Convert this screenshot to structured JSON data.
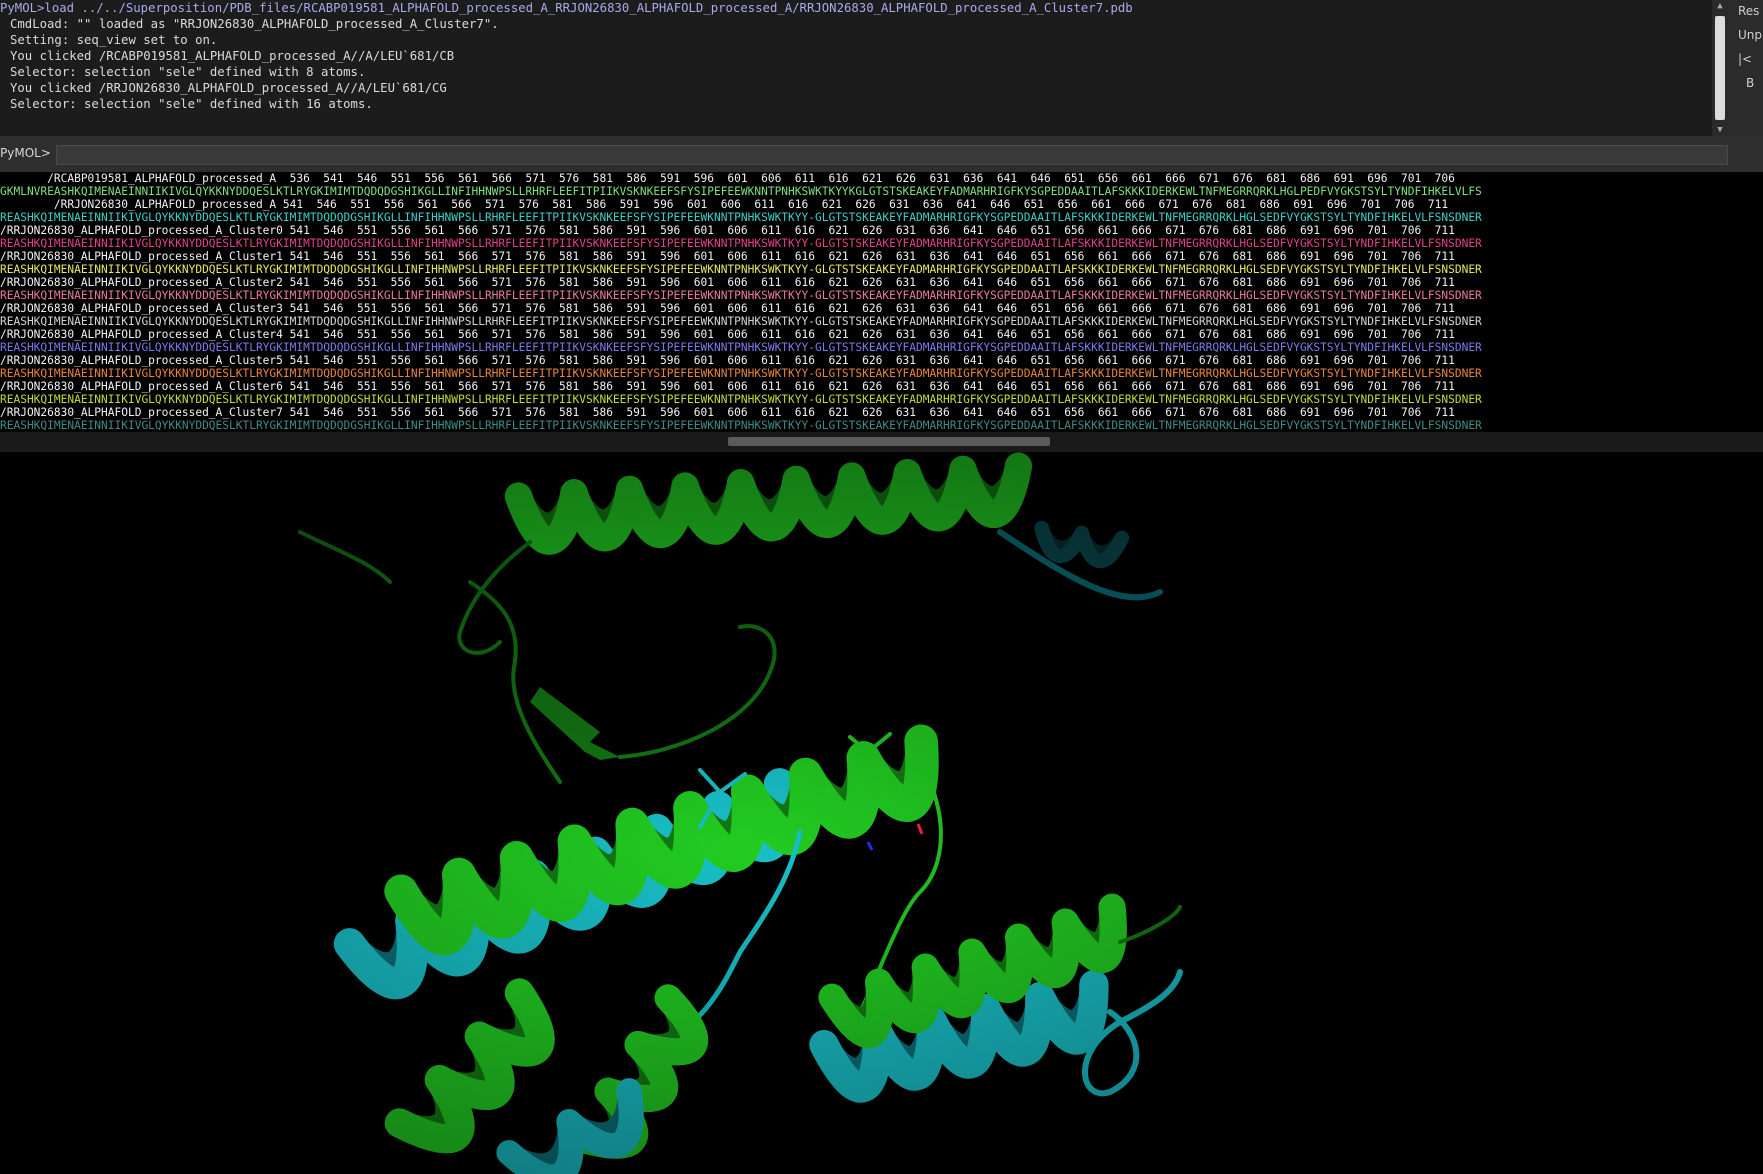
{
  "console": {
    "lines": [
      {
        "cls": "cmd",
        "text": "PyMOL>load ../../Superposition/PDB_files/RCABP019581_ALPHAFOLD_processed_A_RRJON26830_ALPHAFOLD_processed_A/RRJON26830_ALPHAFOLD_processed_A_Cluster7.pdb"
      },
      {
        "cls": "out",
        "text": "CmdLoad: \"\" loaded as \"RRJON26830_ALPHAFOLD_processed_A_Cluster7\"."
      },
      {
        "cls": "out",
        "text": "Setting: seq_view set to on."
      },
      {
        "cls": "out",
        "text": "You clicked /RCABP019581_ALPHAFOLD_processed_A//A/LEU`681/CB"
      },
      {
        "cls": "out",
        "text": "Selector: selection \"sele\" defined with 8 atoms."
      },
      {
        "cls": "out",
        "text": "You clicked /RRJON26830_ALPHAFOLD_processed_A//A/LEU`681/CG"
      },
      {
        "cls": "out",
        "text": "Selector: selection \"sele\" defined with 16 atoms."
      }
    ]
  },
  "right_panel": {
    "buttons": [
      "Res",
      "Unp",
      "|<",
      "B"
    ]
  },
  "command_line": {
    "prompt": "PyMOL>",
    "value": ""
  },
  "sequence_view": {
    "rows": [
      {
        "kind": "nums",
        "text": "       /RCABP019581_ALPHAFOLD_processed_A  536  541  546  551  556  561  566  571  576  581  586  591  596  601  606  611  616  621  626  631  636  641  646  651  656  661  666  671  676  681  686  691  696  701  706"
      },
      {
        "kind": "seq",
        "color": "#7ee07e",
        "text": "GKMLNVREASHKQIMENAEINNIIKIVGLQYKKNYDDQESLKTLRYGKIMIMTDQDQDGSHIKGLLINFIHHNWPSLLRHRFLEEFITPIIKVSKNKEEFSFYSIPEFEEWKNNTPNHKSWKTKYYKGLGTSTSKEAKEYFADMARHRIGFKYSGPEDDAAITLAFSKKKIDERKEWLTNFMEGRRQRKLHGLPEDFVYGKSTSYLTYNDFIHKELVLFS"
      },
      {
        "kind": "nums",
        "text": "        /RRJON26830_ALPHAFOLD_processed_A 541  546  551  556  561  566  571  576  581  586  591  596  601  606  611  616  621  626  631  636  641  646  651  656  661  666  671  676  681  686  691  696  701  706  711"
      },
      {
        "kind": "seq",
        "color": "#3cd0c8",
        "text": "REASHKQIMENAEINNIIKIVGLQYKKNYDDQESLKTLRYGKIMIMTDQDQDGSHIKGLLINFIHHNWPSLLRHRFLEEFITPIIKVSKNKEEFSFYSIPEFEEWKNNTPNHKSWKTKYY-GLGTSTSKEAKEYFADMARHRIGFKYSGPEDDAAITLAFSKKKIDERKEWLTNFMEGRRQRKLHGLSEDFVYGKSTSYLTYNDFIHKELVLFSNSDNER"
      },
      {
        "kind": "nums",
        "text": "/RRJON26830_ALPHAFOLD_processed_A_Cluster0 541  546  551  556  561  566  571  576  581  586  591  596  601  606  611  616  621  626  631  636  641  646  651  656  661  666  671  676  681  686  691  696  701  706  711"
      },
      {
        "kind": "seq",
        "color": "#e0418a",
        "text": "REASHKQIMENAEINNIIKIVGLQYKKNYDDQESLKTLRYGKIMIMTDQDQDGSHIKGLLINFIHHNWPSLLRHRFLEEFITPIIKVSKNKEEFSFYSIPEFEEWKNNTPNHKSWKTKYY-GLGTSTSKEAKEYFADMARHRIGFKYSGPEDDAAITLAFSKKKIDERKEWLTNFMEGRRQRKLHGLSEDFVYGKSTSYLTYNDFIHKELVLFSNSDNER"
      },
      {
        "kind": "nums",
        "text": "/RRJON26830_ALPHAFOLD_processed_A_Cluster1 541  546  551  556  561  566  571  576  581  586  591  596  601  606  611  616  621  626  631  636  641  646  651  656  661  666  671  676  681  686  691  696  701  706  711"
      },
      {
        "kind": "seq",
        "color": "#e8e860",
        "text": "REASHKQIMENAEINNIIKIVGLQYKKNYDDQESLKTLRYGKIMIMTDQDQDGSHIKGLLINFIHHNWPSLLRHRFLEEFITPIIKVSKNKEEFSFYSIPEFEEWKNNTPNHKSWKTKYY-GLGTSTSKEAKEYFADMARHRIGFKYSGPEDDAAITLAFSKKKIDERKEWLTNFMEGRRQRKLHGLSEDFVYGKSTSYLTYNDFIHKELVLFSNSDNER"
      },
      {
        "kind": "nums",
        "text": "/RRJON26830_ALPHAFOLD_processed_A_Cluster2 541  546  551  556  561  566  571  576  581  586  591  596  601  606  611  616  621  626  631  636  641  646  651  656  661  666  671  676  681  686  691  696  701  706  711"
      },
      {
        "kind": "seq",
        "color": "#e87aa0",
        "text": "REASHKQIMENAEINNIIKIVGLQYKKNYDDQESLKTLRYGKIMIMTDQDQDGSHIKGLLINFIHHNWPSLLRHRFLEEFITPIIKVSKNKEEFSFYSIPEFEEWKNNTPNHKSWKTKYY-GLGTSTSKEAKEYFADMARHRIGFKYSGPEDDAAITLAFSKKKIDERKEWLTNFMEGRRQRKLHGLSEDFVYGKSTSYLTYNDFIHKELVLFSNSDNER"
      },
      {
        "kind": "nums",
        "text": "/RRJON26830_ALPHAFOLD_processed_A_Cluster3 541  546  551  556  561  566  571  576  581  586  591  596  601  606  611  616  621  626  631  636  641  646  651  656  661  666  671  676  681  686  691  696  701  706  711"
      },
      {
        "kind": "seq",
        "color": "#d4d4d4",
        "text": "REASHKQIMENAEINNIIKIVGLQYKKNYDDQESLKTLRYGKIMIMTDQDQDGSHIKGLLINFIHHNWPSLLRHRFLEEFITPIIKVSKNKEEFSFYSIPEFEEWKNNTPNHKSWKTKYY-GLGTSTSKEAKEYFADMARHRIGFKYSGPEDDAAITLAFSKKKIDERKEWLTNFMEGRRQRKLHGLSEDFVYGKSTSYLTYNDFIHKELVLFSNSDNER"
      },
      {
        "kind": "nums",
        "text": "/RRJON26830_ALPHAFOLD_processed_A_Cluster4 541  546  551  556  561  566  571  576  581  586  591  596  601  606  611  616  621  626  631  636  641  646  651  656  661  666  671  676  681  686  691  696  701  706  711"
      },
      {
        "kind": "seq",
        "color": "#7a7ae8",
        "text": "REASHKQIMENAEINNIIKIVGLQYKKNYDDQESLKTLRYGKIMIMTDQDQDGSHIKGLLINFIHHNWPSLLRHRFLEEFITPIIKVSKNKEEFSFYSIPEFEEWKNNTPNHKSWKTKYY-GLGTSTSKEAKEYFADMARHRIGFKYSGPEDDAAITLAFSKKKIDERKEWLTNFMEGRRQRKLHGLSEDFVYGKSTSYLTYNDFIHKELVLFSNSDNER"
      },
      {
        "kind": "nums",
        "text": "/RRJON26830_ALPHAFOLD_processed_A_Cluster5 541  546  551  556  561  566  571  576  581  586  591  596  601  606  611  616  621  626  631  636  641  646  651  656  661  666  671  676  681  686  691  696  701  706  711"
      },
      {
        "kind": "seq",
        "color": "#e8843c",
        "text": "REASHKQIMENAEINNIIKIVGLQYKKNYDDQESLKTLRYGKIMIMTDQDQDGSHIKGLLINFIHHNWPSLLRHRFLEEFITPIIKVSKNKEEFSFYSIPEFEEWKNNTPNHKSWKTKYY-GLGTSTSKEAKEYFADMARHRIGFKYSGPEDDAAITLAFSKKKIDERKEWLTNFMEGRRQRKLHGLSEDFVYGKSTSYLTYNDFIHKELVLFSNSDNER"
      },
      {
        "kind": "nums",
        "text": "/RRJON26830_ALPHAFOLD_processed_A_Cluster6 541  546  551  556  561  566  571  576  581  586  591  596  601  606  611  616  621  626  631  636  641  646  651  656  661  666  671  676  681  686  691  696  701  706  711"
      },
      {
        "kind": "seq",
        "color": "#c8d838",
        "text": "REASHKQIMENAEINNIIKIVGLQYKKNYDDQESLKTLRYGKIMIMTDQDQDGSHIKGLLINFIHHNWPSLLRHRFLEEFITPIIKVSKNKEEFSFYSIPEFEEWKNNTPNHKSWKTKYY-GLGTSTSKEAKEYFADMARHRIGFKYSGPEDDAAITLAFSKKKIDERKEWLTNFMEGRRQRKLHGLSEDFVYGKSTSYLTYNDFIHKELVLFSNSDNER"
      },
      {
        "kind": "nums",
        "text": "/RRJON26830_ALPHAFOLD_processed_A_Cluster7 541  546  551  556  561  566  571  576  581  586  591  596  601  606  611  616  621  626  631  636  641  646  651  656  661  666  671  676  681  686  691  696  701  706  711"
      },
      {
        "kind": "seq",
        "color": "#3f8c86",
        "text": "REASHKQIMENAEINNIIKIVGLQYKKNYDDQESLKTLRYGKIMIMTDQDQDGSHIKGLLINFIHHNWPSLLRHRFLEEFITPIIKVSKNKEEFSFYSIPEFEEWKNNTPNHKSWKTKYY-GLGTSTSKEAKEYFADMARHRIGFKYSGPEDDAAITLAFSKKKIDERKEWLTNFMEGRRQRKLHGLSEDFVYGKSTSYLTYNDFIHKELVLFSNSDNER"
      }
    ]
  },
  "viewer": {
    "colors": {
      "green": "#22cc22",
      "green_dark": "#137a13",
      "cyan": "#19c0c8",
      "cyan_dark": "#0b6f7a",
      "background": "#000000"
    }
  }
}
